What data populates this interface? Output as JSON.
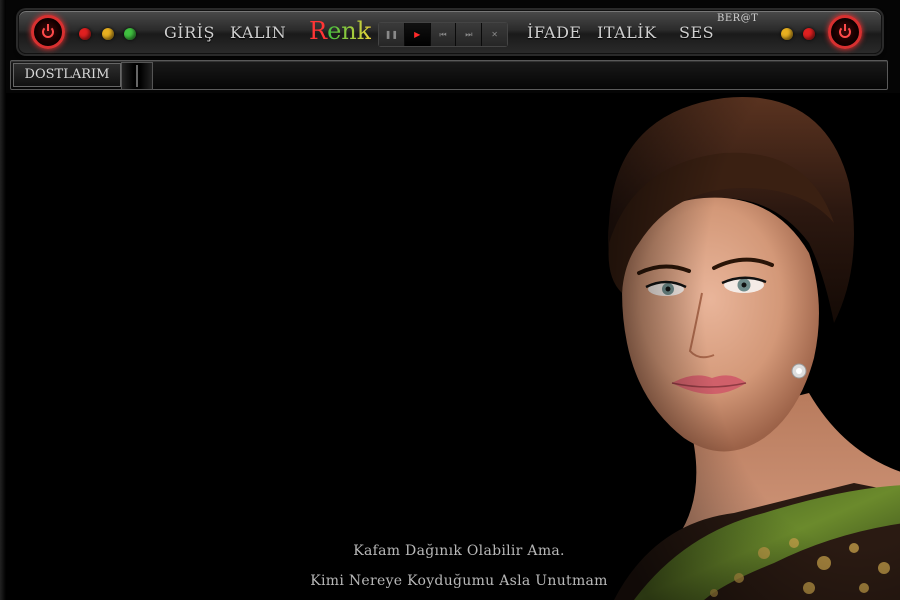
{
  "toolbar": {
    "nav": {
      "giris": "GİRİŞ",
      "kalin": "KALIN",
      "renk_first": "R",
      "renk_rest": "enk",
      "ifade": "İFADE",
      "italik": "ITALİK",
      "ses": "SES"
    },
    "username": "BER@T",
    "left_dots": [
      "#e02020",
      "#e8b020",
      "#40c040"
    ],
    "right_dots": [
      "#e8b020",
      "#e02020"
    ],
    "player_buttons": [
      "pause-icon",
      "play-icon",
      "previous-icon",
      "next-icon",
      "shuffle-icon"
    ],
    "player_glyphs": [
      "❚❚",
      "▶",
      "⏮",
      "⏭",
      "✕"
    ],
    "active_player_button": "play-icon"
  },
  "tabs": {
    "active": "DOSTLARIM"
  },
  "caption": {
    "line1": "Kafam Dağınık Olabilir Ama.",
    "line2": "Kimi Nereye Koyduğumu Asla Unutmam"
  },
  "colors": {
    "power_ring": "#d83030",
    "background": "#000000"
  }
}
